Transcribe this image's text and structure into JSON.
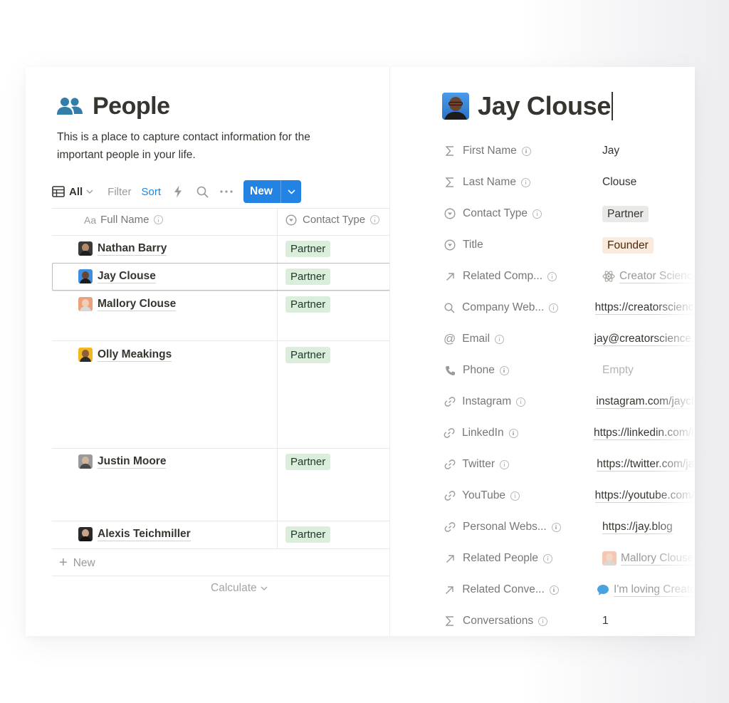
{
  "page": {
    "title": "People",
    "description": "This is a place to capture contact information for the important people in your life."
  },
  "toolbar": {
    "view_label": "All",
    "filter_label": "Filter",
    "sort_label": "Sort",
    "new_label": "New",
    "icons": [
      "table-icon",
      "chevron-down-icon",
      "lightning-icon",
      "search-icon",
      "more-icon"
    ]
  },
  "table": {
    "columns": [
      {
        "prefix": "Aa",
        "label": "Full Name"
      },
      {
        "label": "Contact Type"
      }
    ],
    "rows": [
      {
        "name": "Nathan Barry",
        "contact_type": "Partner"
      },
      {
        "name": "Jay Clouse",
        "contact_type": "Partner"
      },
      {
        "name": "Mallory Clouse",
        "contact_type": "Partner"
      },
      {
        "name": "Olly Meakings",
        "contact_type": "Partner"
      },
      {
        "name": "Justin Moore",
        "contact_type": "Partner"
      },
      {
        "name": "Alexis Teichmiller",
        "contact_type": "Partner"
      }
    ],
    "add_new_label": "New",
    "calculate_label": "Calculate"
  },
  "detail": {
    "name": "Jay Clouse",
    "properties": [
      {
        "label": "First Name",
        "icon": "sigma-icon",
        "value": "Jay"
      },
      {
        "label": "Last Name",
        "icon": "sigma-icon",
        "value": "Clouse"
      },
      {
        "label": "Contact Type",
        "icon": "select-icon",
        "value": "Partner"
      },
      {
        "label": "Title",
        "icon": "select-icon",
        "value": "Founder"
      },
      {
        "label": "Related Comp...",
        "icon": "arrow-up-right-icon",
        "value": "Creator Science"
      },
      {
        "label": "Company Web...",
        "icon": "search-icon",
        "value": "https://creatorscience"
      },
      {
        "label": "Email",
        "icon": "at-icon",
        "value": "jay@creatorscience.c"
      },
      {
        "label": "Phone",
        "icon": "phone-icon",
        "value": "Empty"
      },
      {
        "label": "Instagram",
        "icon": "link-icon",
        "value": "instagram.com/jayclo"
      },
      {
        "label": "LinkedIn",
        "icon": "link-icon",
        "value": "https://linkedin.com/in"
      },
      {
        "label": "Twitter",
        "icon": "link-icon",
        "value": "https://twitter.com/jay"
      },
      {
        "label": "YouTube",
        "icon": "link-icon",
        "value": "https://youtube.com/c"
      },
      {
        "label": "Personal Webs...",
        "icon": "link-icon",
        "value": "https://jay.blog"
      },
      {
        "label": "Related People",
        "icon": "arrow-up-right-icon",
        "value": "Mallory Clouse"
      },
      {
        "label": "Related Conve...",
        "icon": "arrow-up-right-icon",
        "value": "I'm loving Creator"
      },
      {
        "label": "Conversations",
        "icon": "sigma-icon",
        "value": "1"
      }
    ]
  },
  "colors": {
    "accent": "#2383e2",
    "partner_tag_bg": "#dbeddb",
    "founder_tag_bg": "#faebdd",
    "people_icon": "#337ea9"
  }
}
